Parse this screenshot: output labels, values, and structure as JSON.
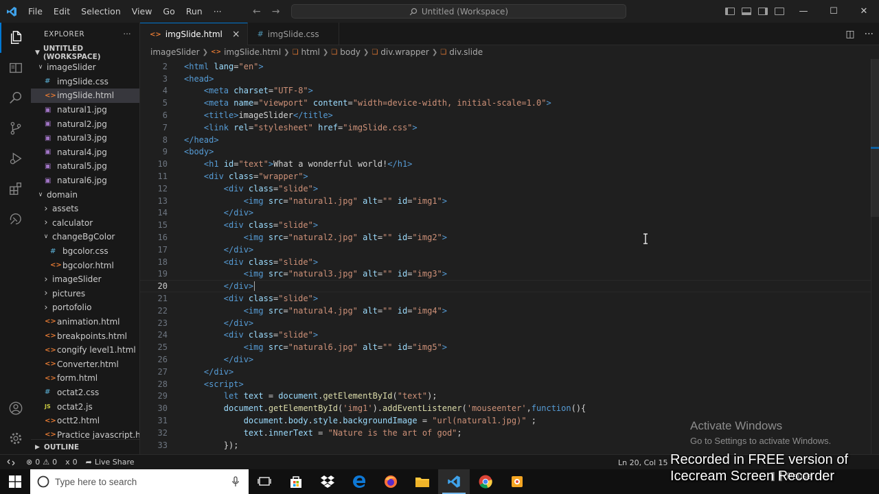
{
  "titlebar": {
    "menu": [
      "File",
      "Edit",
      "Selection",
      "View",
      "Go",
      "Run",
      "···"
    ],
    "search_text": "Untitled (Workspace)",
    "window_controls": [
      "minimize-icon",
      "maximize-icon",
      "close-icon"
    ]
  },
  "explorer": {
    "title": "EXPLORER",
    "more": "···",
    "workspace": "UNTITLED (WORKSPACE)",
    "items": [
      {
        "label": "imageSlider",
        "kind": "folder-open",
        "depth": 1
      },
      {
        "label": "imgSlide.css",
        "kind": "css",
        "depth": 2
      },
      {
        "label": "imgSlide.html",
        "kind": "html",
        "depth": 2,
        "selected": true
      },
      {
        "label": "natural1.jpg",
        "kind": "image",
        "depth": 2
      },
      {
        "label": "natural2.jpg",
        "kind": "image",
        "depth": 2
      },
      {
        "label": "natural3.jpg",
        "kind": "image",
        "depth": 2
      },
      {
        "label": "natural4.jpg",
        "kind": "image",
        "depth": 2
      },
      {
        "label": "natural5.jpg",
        "kind": "image",
        "depth": 2
      },
      {
        "label": "natural6.jpg",
        "kind": "image",
        "depth": 2
      },
      {
        "label": "domain",
        "kind": "folder-open",
        "depth": 1
      },
      {
        "label": "assets",
        "kind": "folder",
        "depth": 2
      },
      {
        "label": "calculator",
        "kind": "folder",
        "depth": 2
      },
      {
        "label": "changeBgColor",
        "kind": "folder-open",
        "depth": 2
      },
      {
        "label": "bgcolor.css",
        "kind": "css",
        "depth": 3
      },
      {
        "label": "bgcolor.html",
        "kind": "html",
        "depth": 3
      },
      {
        "label": "imageSlider",
        "kind": "folder",
        "depth": 2
      },
      {
        "label": "pictures",
        "kind": "folder",
        "depth": 2
      },
      {
        "label": "portofolio",
        "kind": "folder",
        "depth": 2
      },
      {
        "label": "animation.html",
        "kind": "html",
        "depth": 2
      },
      {
        "label": "breakpoints.html",
        "kind": "html",
        "depth": 2
      },
      {
        "label": "congify level1.html",
        "kind": "html",
        "depth": 2
      },
      {
        "label": "Converter.html",
        "kind": "html",
        "depth": 2
      },
      {
        "label": "form.html",
        "kind": "html",
        "depth": 2
      },
      {
        "label": "octat2.css",
        "kind": "css",
        "depth": 2
      },
      {
        "label": "octat2.js",
        "kind": "js",
        "depth": 2
      },
      {
        "label": "octt2.html",
        "kind": "html",
        "depth": 2
      },
      {
        "label": "Practice javascript.ht...",
        "kind": "html",
        "depth": 2
      }
    ],
    "outline": "OUTLINE"
  },
  "tabs": [
    {
      "label": "imgSlide.html",
      "active": true,
      "close": "×"
    },
    {
      "label": "imgSlide.css",
      "active": false
    }
  ],
  "breadcrumb": [
    "imageSlider",
    "imgSlide.html",
    "html",
    "body",
    "div.wrapper",
    "div.slide"
  ],
  "editor": {
    "current_line": 20,
    "lines": [
      {
        "n": "2",
        "tokens": [
          [
            "t-tag",
            "<html "
          ],
          [
            "t-attr",
            "lang"
          ],
          [
            "t-txt",
            "="
          ],
          [
            "t-str",
            "\"en\""
          ],
          [
            "t-tag",
            ">"
          ]
        ]
      },
      {
        "n": "3",
        "tokens": [
          [
            "t-tag",
            "<head>"
          ]
        ]
      },
      {
        "n": "4",
        "tokens": [
          [
            "t-txt",
            "    "
          ],
          [
            "t-tag",
            "<meta "
          ],
          [
            "t-attr",
            "charset"
          ],
          [
            "t-txt",
            "="
          ],
          [
            "t-str",
            "\"UTF-8\""
          ],
          [
            "t-tag",
            ">"
          ]
        ]
      },
      {
        "n": "5",
        "tokens": [
          [
            "t-txt",
            "    "
          ],
          [
            "t-tag",
            "<meta "
          ],
          [
            "t-attr",
            "name"
          ],
          [
            "t-txt",
            "="
          ],
          [
            "t-str",
            "\"viewport\" "
          ],
          [
            "t-attr",
            "content"
          ],
          [
            "t-txt",
            "="
          ],
          [
            "t-str",
            "\"width=device-width, initial-scale=1.0\""
          ],
          [
            "t-tag",
            ">"
          ]
        ]
      },
      {
        "n": "6",
        "tokens": [
          [
            "t-txt",
            "    "
          ],
          [
            "t-tag",
            "<title>"
          ],
          [
            "t-txt",
            "imageSlider"
          ],
          [
            "t-tag",
            "</title>"
          ]
        ]
      },
      {
        "n": "7",
        "tokens": [
          [
            "t-txt",
            "    "
          ],
          [
            "t-tag",
            "<link "
          ],
          [
            "t-attr",
            "rel"
          ],
          [
            "t-txt",
            "="
          ],
          [
            "t-str",
            "\"stylesheet\" "
          ],
          [
            "t-attr",
            "href"
          ],
          [
            "t-txt",
            "="
          ],
          [
            "t-str",
            "\"imgSlide.css\""
          ],
          [
            "t-tag",
            ">"
          ]
        ]
      },
      {
        "n": "8",
        "tokens": [
          [
            "t-tag",
            "</head>"
          ]
        ]
      },
      {
        "n": "9",
        "tokens": [
          [
            "t-tag",
            "<body>"
          ]
        ]
      },
      {
        "n": "10",
        "tokens": [
          [
            "t-txt",
            "    "
          ],
          [
            "t-tag",
            "<h1 "
          ],
          [
            "t-attr",
            "id"
          ],
          [
            "t-txt",
            "="
          ],
          [
            "t-str",
            "\"text\""
          ],
          [
            "t-tag",
            ">"
          ],
          [
            "t-txt",
            "What a wonderful world!"
          ],
          [
            "t-tag",
            "</h1>"
          ]
        ]
      },
      {
        "n": "11",
        "tokens": [
          [
            "t-txt",
            "    "
          ],
          [
            "t-tag",
            "<div "
          ],
          [
            "t-attr",
            "class"
          ],
          [
            "t-txt",
            "="
          ],
          [
            "t-str",
            "\"wrapper\""
          ],
          [
            "t-tag",
            ">"
          ]
        ]
      },
      {
        "n": "12",
        "tokens": [
          [
            "t-txt",
            "        "
          ],
          [
            "t-tag",
            "<div "
          ],
          [
            "t-attr",
            "class"
          ],
          [
            "t-txt",
            "="
          ],
          [
            "t-str",
            "\"slide\""
          ],
          [
            "t-tag",
            ">"
          ]
        ]
      },
      {
        "n": "13",
        "tokens": [
          [
            "t-txt",
            "            "
          ],
          [
            "t-tag",
            "<img "
          ],
          [
            "t-attr",
            "src"
          ],
          [
            "t-txt",
            "="
          ],
          [
            "t-str",
            "\"natural1.jpg\" "
          ],
          [
            "t-attr",
            "alt"
          ],
          [
            "t-txt",
            "="
          ],
          [
            "t-str",
            "\"\" "
          ],
          [
            "t-attr",
            "id"
          ],
          [
            "t-txt",
            "="
          ],
          [
            "t-str",
            "\"img1\""
          ],
          [
            "t-tag",
            ">"
          ]
        ]
      },
      {
        "n": "14",
        "tokens": [
          [
            "t-txt",
            "        "
          ],
          [
            "t-tag",
            "</div>"
          ]
        ]
      },
      {
        "n": "15",
        "tokens": [
          [
            "t-txt",
            "        "
          ],
          [
            "t-tag",
            "<div "
          ],
          [
            "t-attr",
            "class"
          ],
          [
            "t-txt",
            "="
          ],
          [
            "t-str",
            "\"slide\""
          ],
          [
            "t-tag",
            ">"
          ]
        ]
      },
      {
        "n": "16",
        "tokens": [
          [
            "t-txt",
            "            "
          ],
          [
            "t-tag",
            "<img "
          ],
          [
            "t-attr",
            "src"
          ],
          [
            "t-txt",
            "="
          ],
          [
            "t-str",
            "\"natural2.jpg\" "
          ],
          [
            "t-attr",
            "alt"
          ],
          [
            "t-txt",
            "="
          ],
          [
            "t-str",
            "\"\" "
          ],
          [
            "t-attr",
            "id"
          ],
          [
            "t-txt",
            "="
          ],
          [
            "t-str",
            "\"img2\""
          ],
          [
            "t-tag",
            ">"
          ]
        ]
      },
      {
        "n": "17",
        "tokens": [
          [
            "t-txt",
            "        "
          ],
          [
            "t-tag",
            "</div>"
          ]
        ]
      },
      {
        "n": "18",
        "tokens": [
          [
            "t-txt",
            "        "
          ],
          [
            "t-tag",
            "<div "
          ],
          [
            "t-attr",
            "class"
          ],
          [
            "t-txt",
            "="
          ],
          [
            "t-str",
            "\"slide\""
          ],
          [
            "t-tag",
            ">"
          ]
        ]
      },
      {
        "n": "19",
        "tokens": [
          [
            "t-txt",
            "            "
          ],
          [
            "t-tag",
            "<img "
          ],
          [
            "t-attr",
            "src"
          ],
          [
            "t-txt",
            "="
          ],
          [
            "t-str",
            "\"natural3.jpg\" "
          ],
          [
            "t-attr",
            "alt"
          ],
          [
            "t-txt",
            "="
          ],
          [
            "t-str",
            "\"\" "
          ],
          [
            "t-attr",
            "id"
          ],
          [
            "t-txt",
            "="
          ],
          [
            "t-str",
            "\"img3\""
          ],
          [
            "t-tag",
            ">"
          ]
        ]
      },
      {
        "n": "20",
        "tokens": [
          [
            "t-txt",
            "        "
          ],
          [
            "t-tag",
            "</div>"
          ]
        ]
      },
      {
        "n": "21",
        "tokens": [
          [
            "t-txt",
            "        "
          ],
          [
            "t-tag",
            "<div "
          ],
          [
            "t-attr",
            "class"
          ],
          [
            "t-txt",
            "="
          ],
          [
            "t-str",
            "\"slide\""
          ],
          [
            "t-tag",
            ">"
          ]
        ]
      },
      {
        "n": "22",
        "tokens": [
          [
            "t-txt",
            "            "
          ],
          [
            "t-tag",
            "<img "
          ],
          [
            "t-attr",
            "src"
          ],
          [
            "t-txt",
            "="
          ],
          [
            "t-str",
            "\"natural4.jpg\" "
          ],
          [
            "t-attr",
            "alt"
          ],
          [
            "t-txt",
            "="
          ],
          [
            "t-str",
            "\"\" "
          ],
          [
            "t-attr",
            "id"
          ],
          [
            "t-txt",
            "="
          ],
          [
            "t-str",
            "\"img4\""
          ],
          [
            "t-tag",
            ">"
          ]
        ]
      },
      {
        "n": "23",
        "tokens": [
          [
            "t-txt",
            "        "
          ],
          [
            "t-tag",
            "</div>"
          ]
        ]
      },
      {
        "n": "24",
        "tokens": [
          [
            "t-txt",
            "        "
          ],
          [
            "t-tag",
            "<div "
          ],
          [
            "t-attr",
            "class"
          ],
          [
            "t-txt",
            "="
          ],
          [
            "t-str",
            "\"slide\""
          ],
          [
            "t-tag",
            ">"
          ]
        ]
      },
      {
        "n": "25",
        "tokens": [
          [
            "t-txt",
            "            "
          ],
          [
            "t-tag",
            "<img "
          ],
          [
            "t-attr",
            "src"
          ],
          [
            "t-txt",
            "="
          ],
          [
            "t-str",
            "\"natural6.jpg\" "
          ],
          [
            "t-attr",
            "alt"
          ],
          [
            "t-txt",
            "="
          ],
          [
            "t-str",
            "\"\" "
          ],
          [
            "t-attr",
            "id"
          ],
          [
            "t-txt",
            "="
          ],
          [
            "t-str",
            "\"img5\""
          ],
          [
            "t-tag",
            ">"
          ]
        ]
      },
      {
        "n": "26",
        "tokens": [
          [
            "t-txt",
            "        "
          ],
          [
            "t-tag",
            "</div>"
          ]
        ]
      },
      {
        "n": "27",
        "tokens": [
          [
            "t-txt",
            "    "
          ],
          [
            "t-tag",
            "</div>"
          ]
        ]
      },
      {
        "n": "28",
        "tokens": [
          [
            "t-txt",
            "    "
          ],
          [
            "t-tag",
            "<script>"
          ]
        ]
      },
      {
        "n": "29",
        "tokens": [
          [
            "t-txt",
            "        "
          ],
          [
            "t-kw",
            "let "
          ],
          [
            "t-var",
            "text"
          ],
          [
            "t-txt",
            " = "
          ],
          [
            "t-var",
            "document"
          ],
          [
            "t-txt",
            "."
          ],
          [
            "t-fn",
            "getElementById"
          ],
          [
            "t-txt",
            "("
          ],
          [
            "t-str",
            "\"text\""
          ],
          [
            "t-txt",
            ");"
          ]
        ]
      },
      {
        "n": "30",
        "tokens": [
          [
            "t-txt",
            "        "
          ],
          [
            "t-var",
            "document"
          ],
          [
            "t-txt",
            "."
          ],
          [
            "t-fn",
            "getElementById"
          ],
          [
            "t-txt",
            "("
          ],
          [
            "t-str",
            "'img1'"
          ],
          [
            "t-txt",
            ")."
          ],
          [
            "t-fn",
            "addEventListener"
          ],
          [
            "t-txt",
            "("
          ],
          [
            "t-str",
            "'mouseenter'"
          ],
          [
            "t-txt",
            ","
          ],
          [
            "t-kw",
            "function"
          ],
          [
            "t-txt",
            "(){"
          ]
        ]
      },
      {
        "n": "31",
        "tokens": [
          [
            "t-txt",
            "            "
          ],
          [
            "t-var",
            "document"
          ],
          [
            "t-txt",
            "."
          ],
          [
            "t-var",
            "body"
          ],
          [
            "t-txt",
            "."
          ],
          [
            "t-var",
            "style"
          ],
          [
            "t-txt",
            "."
          ],
          [
            "t-var",
            "backgroundImage"
          ],
          [
            "t-txt",
            " = "
          ],
          [
            "t-str",
            "\"url(natural1.jpg)\""
          ],
          [
            "t-txt",
            " ;"
          ]
        ]
      },
      {
        "n": "32",
        "tokens": [
          [
            "t-txt",
            "            "
          ],
          [
            "t-var",
            "text"
          ],
          [
            "t-txt",
            "."
          ],
          [
            "t-var",
            "innerText"
          ],
          [
            "t-txt",
            " = "
          ],
          [
            "t-str",
            "\"Nature is the art of god\""
          ],
          [
            "t-txt",
            ";"
          ]
        ]
      },
      {
        "n": "33",
        "tokens": [
          [
            "t-txt",
            "        "
          ],
          [
            "t-txt",
            "});"
          ]
        ]
      }
    ]
  },
  "activate_windows": {
    "title": "Activate Windows",
    "subtitle": "Go to Settings to activate Windows."
  },
  "statusbar": {
    "errors": "0",
    "warnings": "0",
    "ports": "0",
    "live_share": "Live Share",
    "position": "Ln 20, Col 15"
  },
  "watermark": {
    "line1": "Recorded in FREE version of",
    "line2": "Icecream Screen Recorder",
    "pause": "Pause"
  },
  "taskbar": {
    "search_placeholder": "Type here to search",
    "apps": [
      "task-view-icon",
      "store-icon",
      "dropbox-icon",
      "edge-icon",
      "firefox-icon",
      "file-explorer-icon",
      "vscode-icon",
      "chrome-icon",
      "icecream-recorder-icon"
    ],
    "active_app": "vscode-icon"
  }
}
